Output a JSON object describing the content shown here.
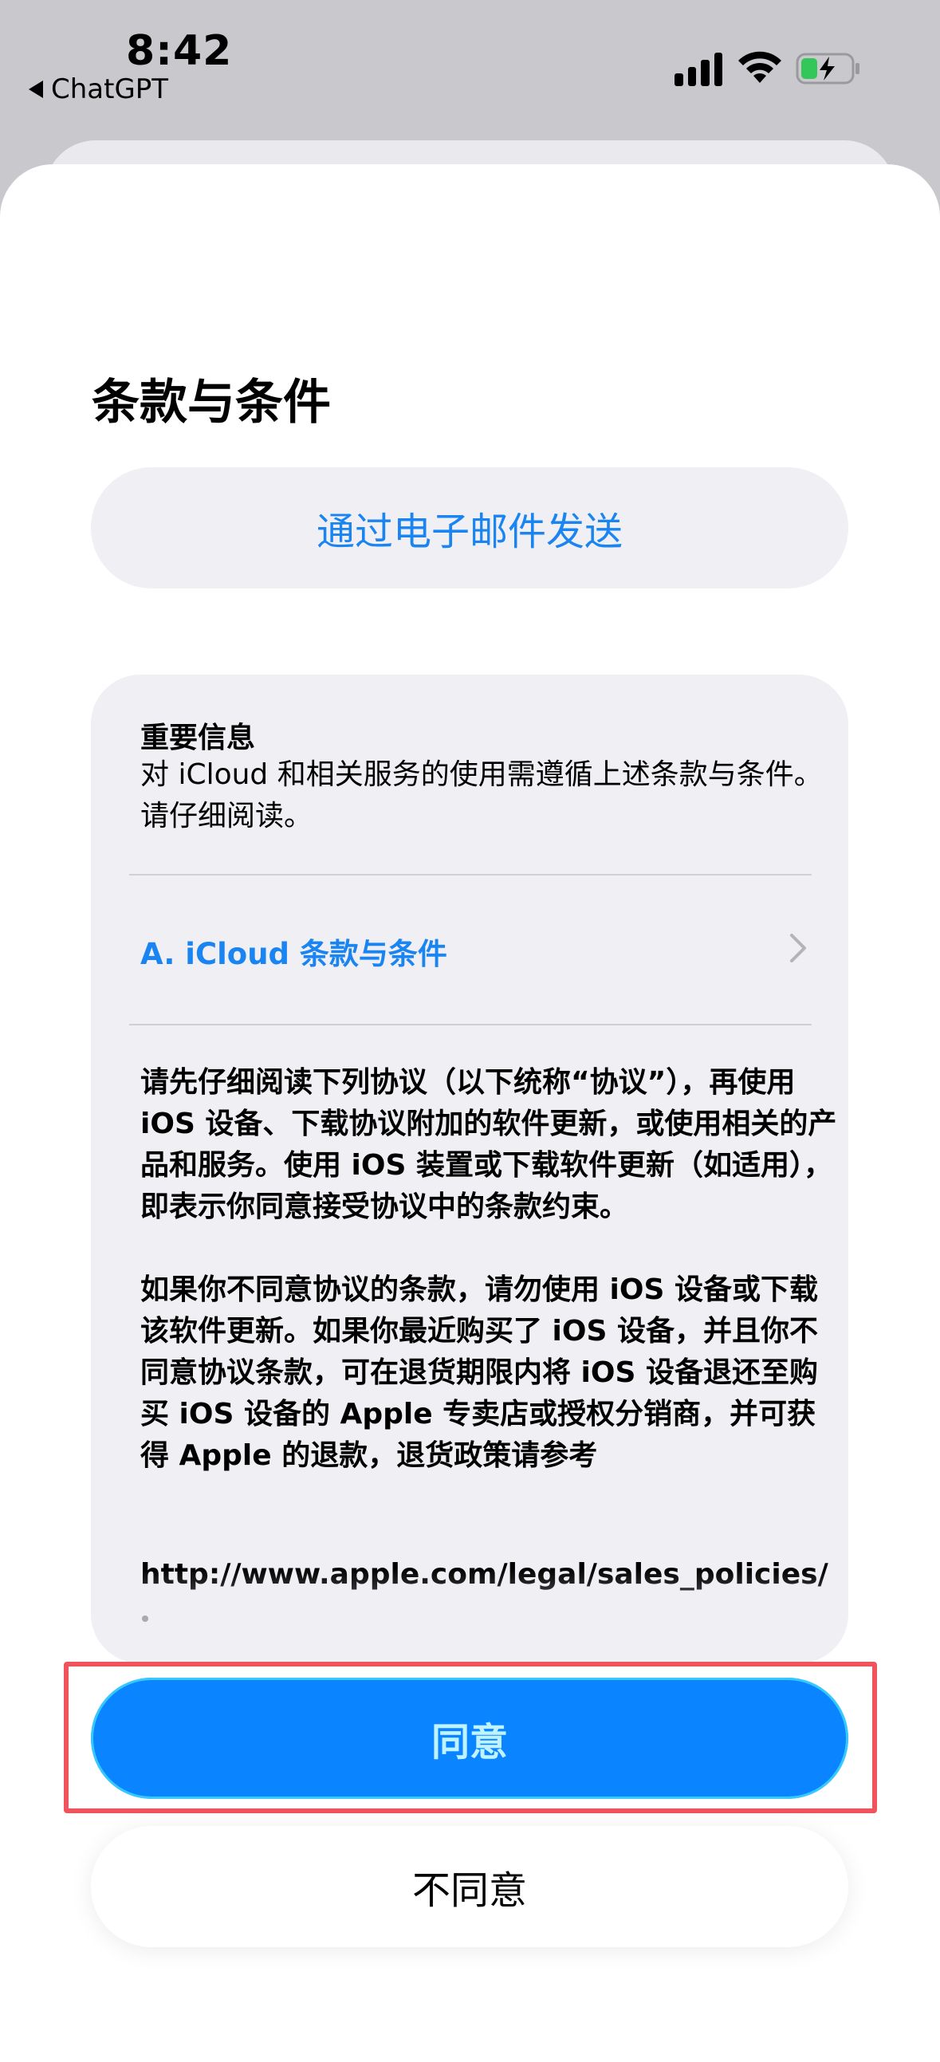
{
  "status_bar": {
    "time": "8:42",
    "back_app": "ChatGPT",
    "icons": [
      "signal-icon",
      "wifi-icon",
      "battery-charging-icon"
    ]
  },
  "sheet": {
    "title": "条款与条件",
    "email_button": "通过电子邮件发送",
    "card": {
      "info_heading": "重要信息",
      "info_text": "对 iCloud 和相关服务的使用需遵循上述条款与条件。请仔细阅读。",
      "link_label": "A. iCloud 条款与条件",
      "paragraph1": "请先仔细阅读下列协议（以下统称“协议”），再使用 iOS 设备、下载协议附加的软件更新，或使用相关的产品和服务。使用 iOS 装置或下载软件更新（如适用），即表示你同意接受协议中的条款约束。",
      "paragraph2": "如果你不同意协议的条款，请勿使用 iOS 设备或下载该软件更新。如果你最近购买了 iOS 设备，并且你不同意协议条款，可在退货期限内将 iOS 设备退还至购买 iOS 设备的 Apple 专卖店或授权分销商，并可获得 Apple 的退款，退货政策请参考",
      "url": "http://www.apple.com/legal/sales_policies/"
    },
    "agree_button": "同意",
    "disagree_button": "不同意"
  },
  "colors": {
    "accent": "#0a84ff",
    "link": "#1a84f0",
    "highlight_frame": "#f0535b"
  }
}
